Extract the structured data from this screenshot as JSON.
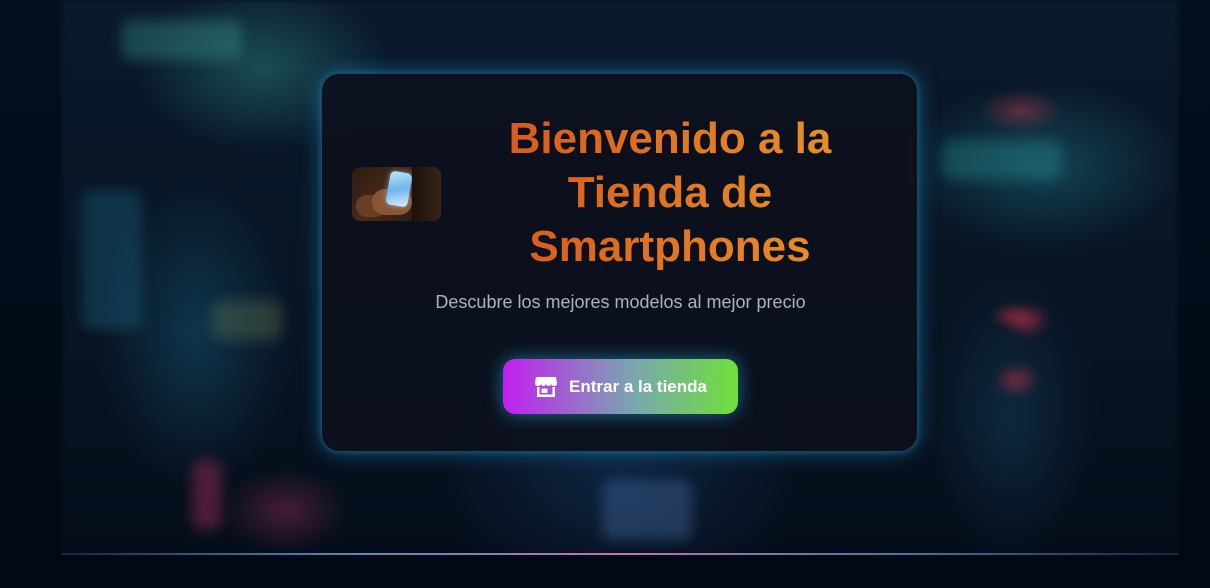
{
  "hero": {
    "title": "Bienvenido a la Tienda de Smartphones",
    "subtitle": "Descubre los mejores modelos al mejor precio",
    "image_description_icon": "smartphone-in-hand-photo"
  },
  "cta": {
    "label": "Entrar a la tienda",
    "icon": "store-icon",
    "gradient": [
      "#c21ff0",
      "#7aa6b0",
      "#6fe03a"
    ]
  },
  "colors": {
    "title_gradient": [
      "#d9541a",
      "#e8962a"
    ],
    "card_glow": "#1eaae6",
    "page_background": "#030a15"
  }
}
